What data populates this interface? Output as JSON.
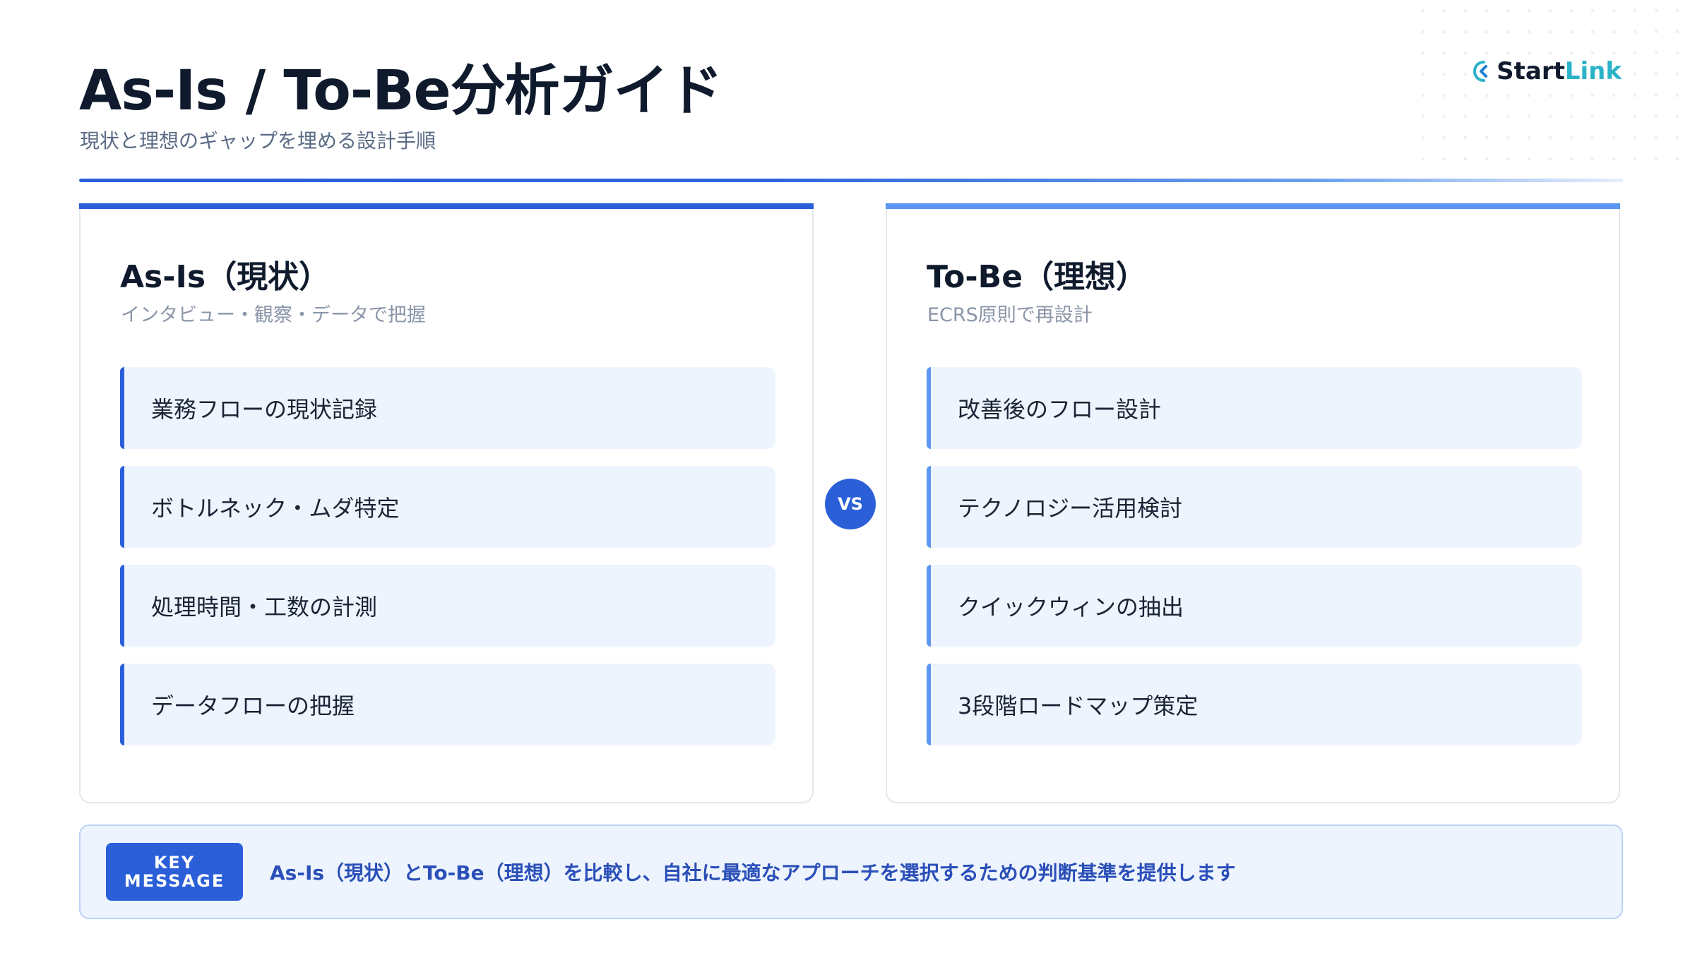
{
  "header": {
    "title": "As-Is / To-Be分析ガイド",
    "subtitle": "現状と理想のギャップを埋める設計手順"
  },
  "logo": {
    "icon": "startlink-logo-icon",
    "text_main": "Start",
    "text_accent": "Link"
  },
  "as_is": {
    "heading": "As-Is（現状）",
    "subheading": "インタビュー・観察・データで把握",
    "items": [
      "業務フローの現状記録",
      "ボトルネック・ムダ特定",
      "処理時間・工数の計測",
      "データフローの把握"
    ]
  },
  "to_be": {
    "heading": "To-Be（理想）",
    "subheading": "ECRS原則で再設計",
    "items": [
      "改善後のフロー設計",
      "テクノロジー活用検討",
      "クイックウィンの抽出",
      "3段階ロードマップ策定"
    ]
  },
  "vs_label": "VS",
  "key_message": {
    "tag_line1": "KEY",
    "tag_line2": "MESSAGE",
    "text": "As-Is（現状）とTo-Be（理想）を比較し、自社に最適なアプローチを選択するための判断基準を提供します"
  },
  "colors": {
    "primary": "#2a5fd8",
    "secondary": "#5b97f0",
    "accent": "#2bb3c8",
    "card_bg": "#eef4fe",
    "text_dark": "#0f1b2d"
  }
}
